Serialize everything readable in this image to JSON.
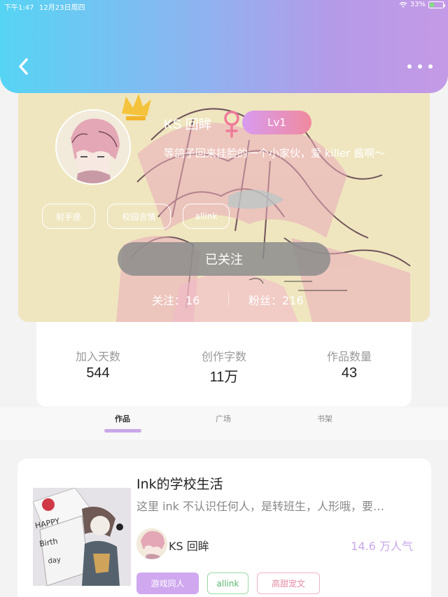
{
  "status_bar": {
    "time": "下午1:47",
    "date": "12月23日周四",
    "battery": "33%",
    "battery_level": 0.33
  },
  "header": {
    "back_icon": "chevron-left-icon",
    "more_icon": "more-dots-icon"
  },
  "profile": {
    "username": "KS 回眸",
    "level": "Lv1",
    "bio": "等鸽子回来挂脸的一个小家伙，爱 killer 酱啊～",
    "tags": [
      "射手座",
      "校园言情",
      "allink"
    ],
    "follow_button": "已关注",
    "following_label": "关注：16",
    "fans_label": "粉丝：216"
  },
  "stats": [
    {
      "label": "加入天数",
      "value": "544"
    },
    {
      "label": "创作字数",
      "value": "11万"
    },
    {
      "label": "作品数量",
      "value": "43"
    }
  ],
  "tabs": [
    {
      "label": "作品",
      "active": true
    },
    {
      "label": "广场",
      "active": false
    },
    {
      "label": "书架",
      "active": false
    }
  ],
  "work": {
    "title": "Ink的学校生活",
    "description": "这里 ink 不认识任何人，是转班生，人形哦，要…",
    "author": "KS 回眸",
    "popularity": "14.6 万人气",
    "tags": [
      "游戏同人",
      "allink",
      "高甜宠文"
    ]
  },
  "colors": {
    "accent": "#c8a8e8",
    "header_gradient_start": "#56d4f4",
    "header_gradient_end": "#c49ae6"
  }
}
